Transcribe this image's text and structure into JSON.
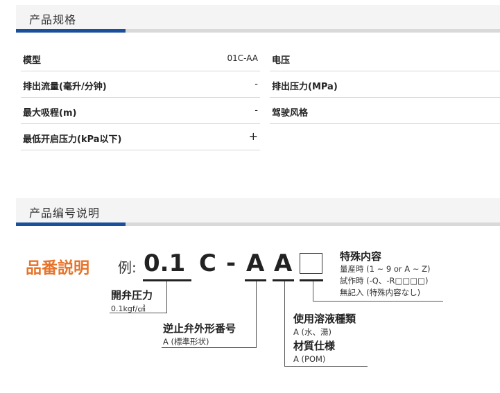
{
  "specs_section": {
    "title": "产品规格",
    "left": [
      {
        "label": "模型",
        "value": "01C-AA"
      },
      {
        "label": "排出流量(毫升/分钟)",
        "value": "-"
      },
      {
        "label": "最大吸程(m)",
        "value": "-"
      },
      {
        "label": "最低开启压力(kPa以下)",
        "value": "+"
      }
    ],
    "right": [
      {
        "label": "电压",
        "value": ""
      },
      {
        "label": "排出压力(MPa)",
        "value": ""
      },
      {
        "label": "驾驶风格",
        "value": ""
      }
    ]
  },
  "code_section": {
    "title": "产品编号说明",
    "heading": "品番説明",
    "example_prefix": "例:",
    "chars": [
      "0.1",
      "C",
      "-",
      "A",
      "A"
    ],
    "annotations": {
      "special": {
        "title": "特殊内容",
        "lines": [
          "量産時 (1 ~ 9 or A ~ Z)",
          "試作時 (-Q、-R□□□□)",
          "無記入 (特殊内容なし)"
        ]
      },
      "pressure": {
        "title": "開弁圧力",
        "lines": [
          "0.1kgf/㎠"
        ]
      },
      "valve": {
        "title": "逆止弁外形番号",
        "lines": [
          "A (標準形状)"
        ]
      },
      "fluid": {
        "title": "使用溶液種類",
        "lines": [
          "A (水、湯)"
        ]
      },
      "material": {
        "title": "材質仕様",
        "lines": [
          "A (POM)"
        ]
      }
    },
    "colors": {
      "heading": "#e8742a",
      "accent": "#1a4f9c"
    }
  }
}
